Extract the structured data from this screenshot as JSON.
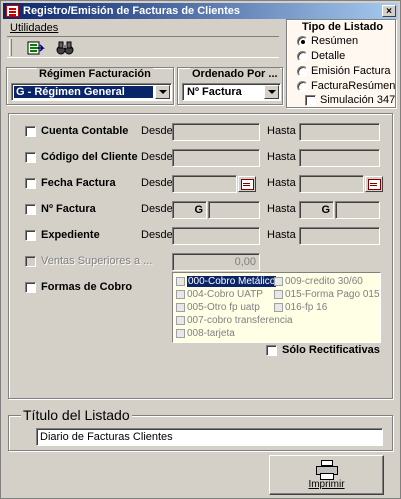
{
  "window": {
    "title": "Registro/Emisión de Facturas de Clientes",
    "close_label": "×"
  },
  "menu": {
    "utilidades": "Utilidades"
  },
  "tipo_listado": {
    "title": "Tipo de Listado",
    "options": [
      {
        "label": "Resúmen",
        "selected": true
      },
      {
        "label": "Detalle",
        "selected": false
      },
      {
        "label": "Emisión Factura",
        "selected": false
      },
      {
        "label": "FacturaResúmen",
        "selected": false
      }
    ],
    "simulacion_label": "Simulación 347"
  },
  "regimen": {
    "title": "Régimen Facturación",
    "value": "G - Régimen General"
  },
  "ordenado": {
    "title": "Ordenado Por ...",
    "value": "Nº Factura"
  },
  "filters": {
    "desde": "Desde",
    "hasta": "Hasta",
    "cuenta_contable": "Cuenta Contable",
    "codigo_cliente": "Código del Cliente",
    "fecha_factura": "Fecha Factura",
    "n_factura": "Nº Factura",
    "n_factura_desde_prefix": "G",
    "n_factura_hasta_prefix": "G",
    "expediente": "Expediente",
    "ventas_superiores": "Ventas Superiores a ...",
    "ventas_value": "0,00",
    "formas_cobro": "Formas de Cobro",
    "solo_rectificativas": "Sólo Rectificativas"
  },
  "formas_cobro_list": [
    {
      "label": "000-Cobro Metálico",
      "selected": true
    },
    {
      "label": "004-Cobro UATP",
      "selected": false
    },
    {
      "label": "005-Otro fp uatp",
      "selected": false
    },
    {
      "label": "007-cobro transferencia",
      "selected": false
    },
    {
      "label": "008-tarjeta",
      "selected": false
    },
    {
      "label": "009-credito 30/60",
      "selected": false
    },
    {
      "label": "015-Forma Pago 015",
      "selected": false
    },
    {
      "label": "016-fp 16",
      "selected": false
    }
  ],
  "titulo": {
    "title": "Título del Listado",
    "value": "Diario de Facturas Clientes"
  },
  "imprimir": {
    "label": "Imprimir"
  },
  "colors": {
    "titlebar_start": "#0a246a",
    "titlebar_end": "#a6caf0",
    "face": "#d4d0c8",
    "list_bg": "#ffffe6"
  }
}
